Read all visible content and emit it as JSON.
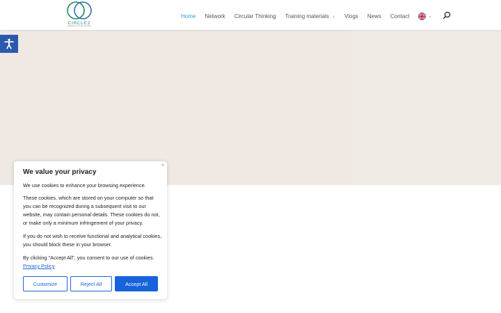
{
  "logo": {
    "name": "CIRCLE2",
    "tagline": "towards a circular economy"
  },
  "nav": {
    "items": [
      {
        "label": "Home",
        "active": true
      },
      {
        "label": "Network"
      },
      {
        "label": "Circular Thinking"
      },
      {
        "label": "Training materials",
        "has_dropdown": true
      },
      {
        "label": "Vlogs"
      },
      {
        "label": "News"
      },
      {
        "label": "Contact"
      }
    ],
    "language_icon": "uk-flag-icon",
    "search_icon": "search-icon"
  },
  "accessibility": {
    "icon": "accessibility-icon"
  },
  "cookie": {
    "close": "×",
    "title": "We value your privacy",
    "p1": "We use cookies to enhance your browsing experience.",
    "p2": "These cookies, which are stored on your computer so that you can be recognized during a subsequent visit to our website, may contain personal details.  These cookies do not, or make only a minimum infringement of your privacy.",
    "p3": "If you do not wish to receive functional and analytical cookies, you should block these in your browser.",
    "p4": "By clicking \"Accept All\", you consent to our use of cookies.",
    "policy_link": "Privacy Policy",
    "customize": "Customize",
    "reject": "Reject All",
    "accept": "Accept All"
  },
  "colors": {
    "accent": "#2e9fd4",
    "hero_bg": "#efe8e3",
    "accessibility_bg": "#2b59ae",
    "cookie_button": "#1863dc"
  }
}
